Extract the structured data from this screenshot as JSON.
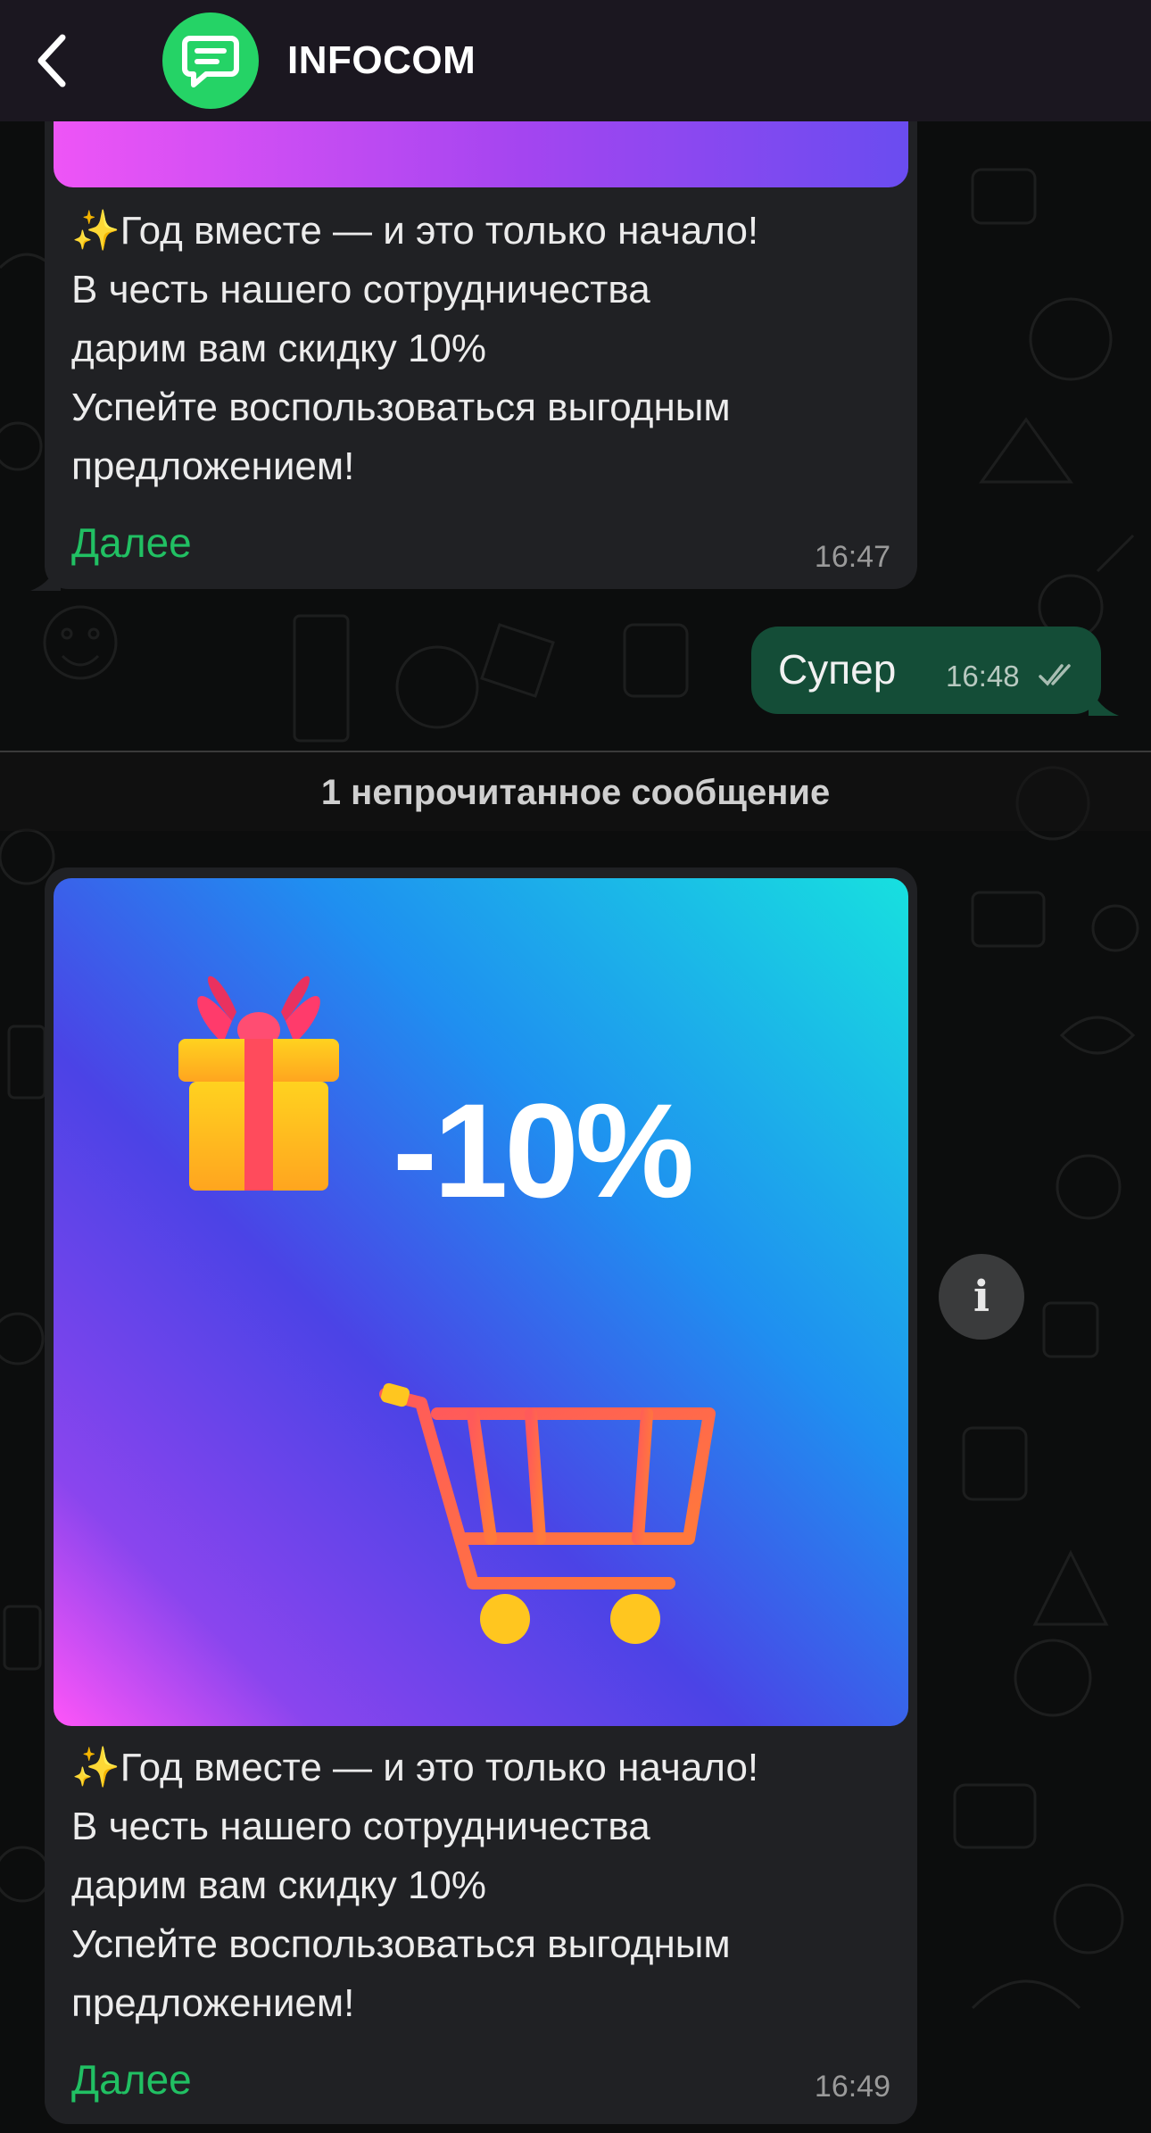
{
  "header": {
    "title": "INFOCOM",
    "back_icon": "chevron-left-icon",
    "avatar_icon": "chat-bubble-icon",
    "avatar_color": "#25d366"
  },
  "messages": [
    {
      "text": "✨Год вместе — и это только начало!\nВ честь нашего сотрудничества\nдарим вам скидку 10%\nУспейте воспользоваться выгодным\nпредложением!",
      "link": "Далее",
      "time": "16:47"
    },
    {
      "text": "Супер",
      "time": "16:48",
      "status_icon": "double-check-icon"
    },
    {
      "text": "✨Год вместе — и это только начало!\nВ честь нашего сотрудничества\nдарим вам скидку 10%\nУспейте воспользоваться выгодным\nпредложением!",
      "link": "Далее",
      "time": "16:49",
      "image": {
        "discount": "-10%",
        "icons": [
          "gift-icon",
          "shopping-cart-icon"
        ]
      }
    }
  ],
  "unread_label": "1 непрочитанное сообщение",
  "info_button_icon": "info-icon",
  "colors": {
    "link": "#21c063",
    "outgoing_bubble": "#144d37",
    "incoming_bubble": "#202124",
    "header_bg": "#1b1720"
  }
}
